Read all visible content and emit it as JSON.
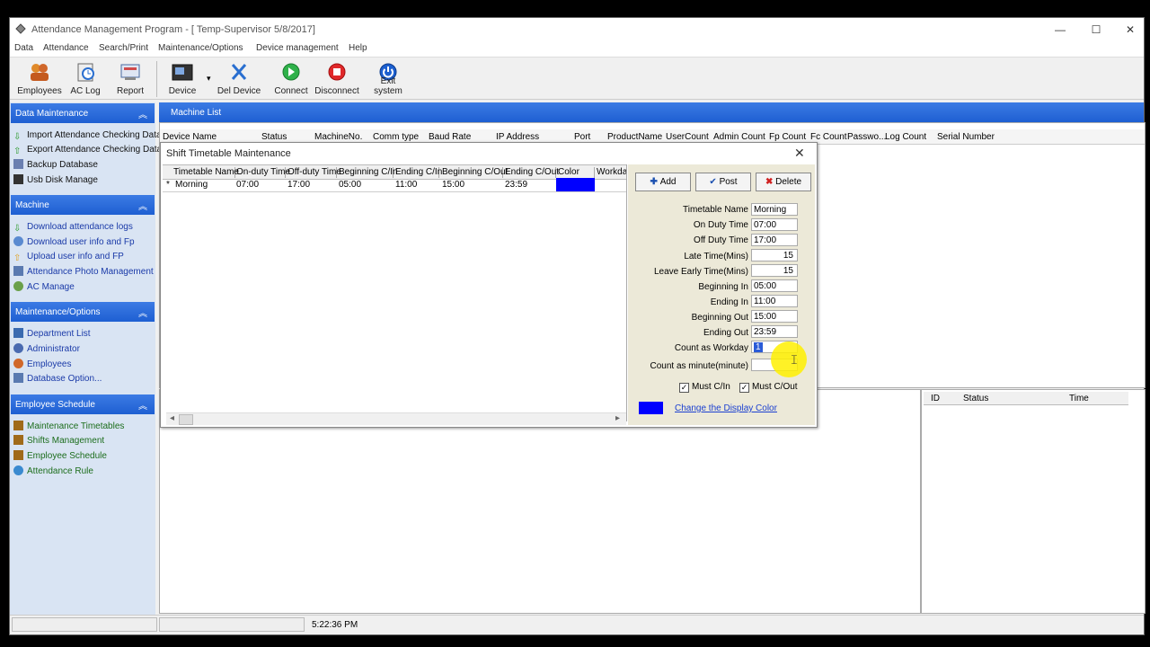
{
  "window": {
    "title": "Attendance Management Program - [ Temp-Supervisor 5/8/2017]",
    "minimize": "—",
    "maximize": "☐",
    "close": "✕"
  },
  "menu": [
    "Data",
    "Attendance",
    "Search/Print",
    "Maintenance/Options",
    "Device management",
    "Help"
  ],
  "toolbar": {
    "employees": "Employees",
    "ac_log": "AC Log",
    "report": "Report",
    "device": "Device",
    "del_device": "Del Device",
    "connect": "Connect",
    "disconnect": "Disconnect",
    "exit": "Exit system"
  },
  "sidebar": {
    "data_maintenance": {
      "title": "Data Maintenance",
      "items": [
        "Import Attendance Checking Data",
        "Export Attendance Checking Data",
        "Backup Database",
        "Usb Disk Manage"
      ]
    },
    "machine": {
      "title": "Machine",
      "items": [
        "Download attendance logs",
        "Download user info and Fp",
        "Upload user info and FP",
        "Attendance Photo Management",
        "AC Manage"
      ]
    },
    "maintenance": {
      "title": "Maintenance/Options",
      "items": [
        "Department List",
        "Administrator",
        "Employees",
        "Database Option..."
      ]
    },
    "schedule": {
      "title": "Employee Schedule",
      "items": [
        "Maintenance Timetables",
        "Shifts Management",
        "Employee Schedule",
        "Attendance Rule"
      ]
    }
  },
  "machine_list": {
    "title": "Machine List",
    "columns": [
      "Device Name",
      "Status",
      "MachineNo.",
      "Comm type",
      "Baud Rate",
      "IP Address",
      "Port",
      "ProductName",
      "UserCount",
      "Admin Count",
      "Fp Count",
      "Fc Count",
      "Passwo...",
      "Log Count",
      "Serial Number"
    ]
  },
  "log_columns": [
    "ID",
    "Status",
    "Time"
  ],
  "status_time": "5:22:36 PM",
  "dialog": {
    "title": "Shift Timetable Maintenance",
    "close": "✕",
    "columns": [
      "Timetable Name",
      "On-duty Time",
      "Off-duty Time",
      "Beginning C/In",
      "Ending C/In",
      "Beginning C/Out",
      "Ending C/Out",
      "Color",
      "Workda"
    ],
    "row_marker": "*",
    "row": [
      "Morning",
      "07:00",
      "17:00",
      "05:00",
      "11:00",
      "15:00",
      "23:59"
    ],
    "row_color": "#0000ff",
    "buttons": {
      "add": "Add",
      "post": "Post",
      "delete": "Delete"
    },
    "form": {
      "timetable_name": {
        "label": "Timetable Name",
        "value": "Morning"
      },
      "on_duty": {
        "label": "On Duty Time",
        "value": "07:00"
      },
      "off_duty": {
        "label": "Off Duty Time",
        "value": "17:00"
      },
      "late": {
        "label": "Late Time(Mins)",
        "value": "15"
      },
      "leave_early": {
        "label": "Leave Early Time(Mins)",
        "value": "15"
      },
      "beginning_in": {
        "label": "Beginning In",
        "value": "05:00"
      },
      "ending_in": {
        "label": "Ending In",
        "value": "11:00"
      },
      "beginning_out": {
        "label": "Beginning Out",
        "value": "15:00"
      },
      "ending_out": {
        "label": "Ending Out",
        "value": "23:59"
      },
      "workday": {
        "label": "Count as Workday",
        "value": "1"
      },
      "minute": {
        "label": "Count as minute(minute)",
        "value": ""
      }
    },
    "must_cin": "Must C/In",
    "must_cout": "Must C/Out",
    "check_mark": "✓",
    "display_color": "#0000ff",
    "change_color": "Change the Display Color"
  }
}
